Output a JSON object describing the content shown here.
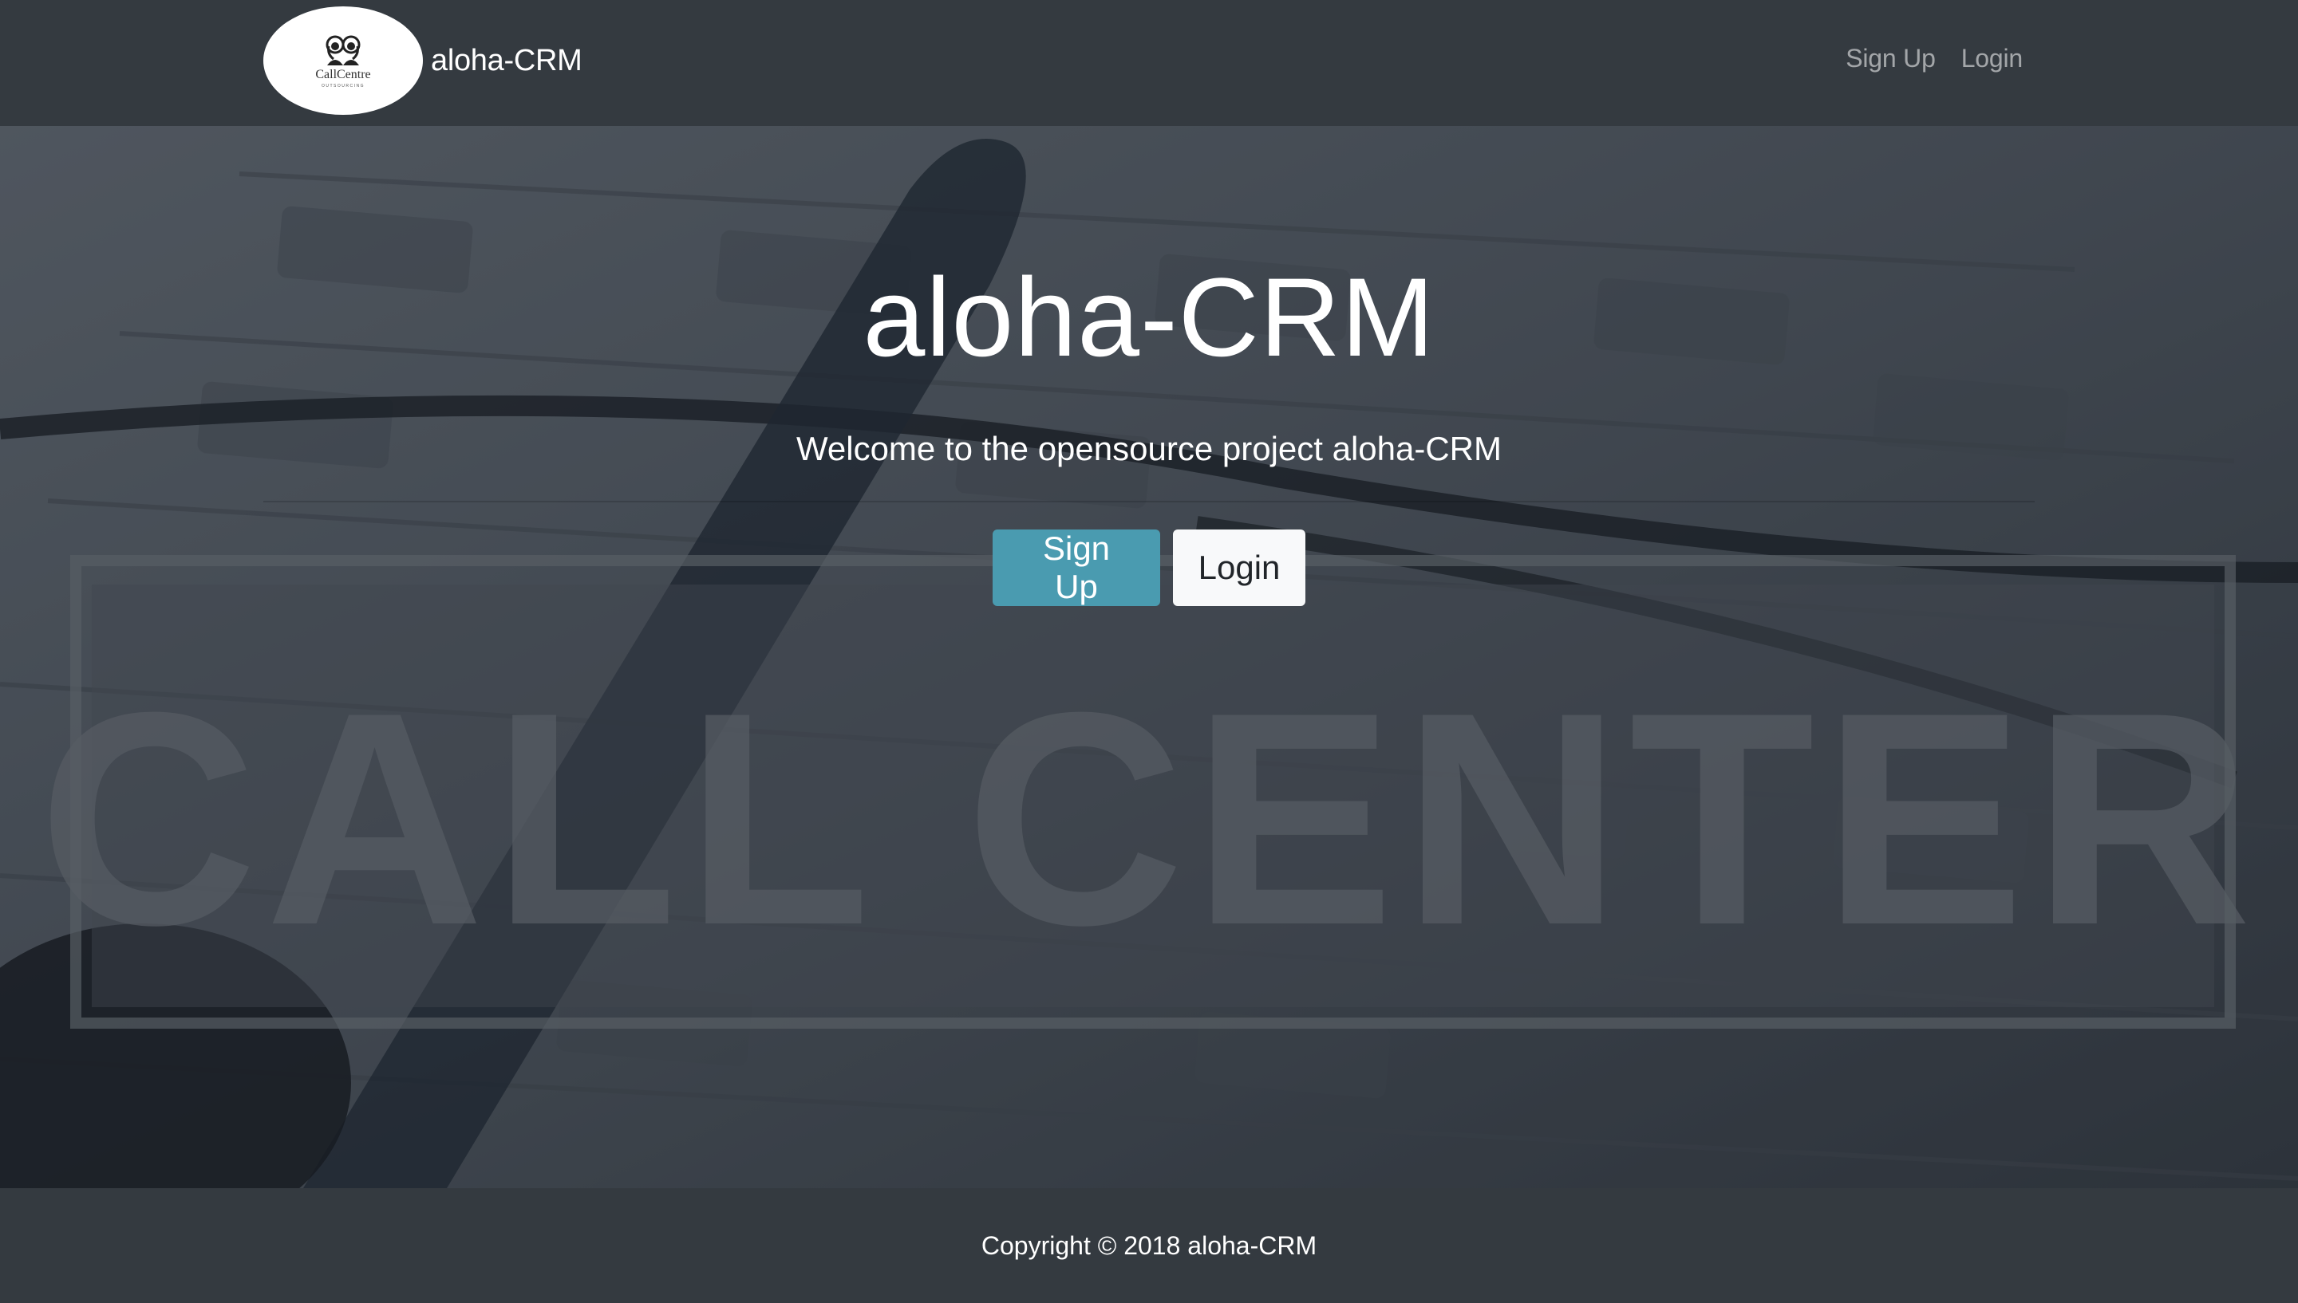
{
  "navbar": {
    "logo": {
      "text": "CallCentre",
      "tagline": "OUTSOURCING",
      "icon": "headset-people-icon"
    },
    "brand_name": "aloha-CRM",
    "links": [
      {
        "label": "Sign Up"
      },
      {
        "label": "Login"
      }
    ]
  },
  "hero": {
    "background_image_text": "CALL CENTER",
    "title": "aloha-CRM",
    "lead": "Welcome to the opensource project aloha-CRM",
    "buttons": {
      "signup_label": "Sign Up",
      "login_label": "Login"
    }
  },
  "footer": {
    "copyright": "Copyright © 2018 aloha-CRM"
  },
  "colors": {
    "navbar_bg": "#343a40",
    "info_button": "#4a9bb0",
    "light_button": "#f8f9fa",
    "nav_link": "rgba(255,255,255,0.55)"
  }
}
